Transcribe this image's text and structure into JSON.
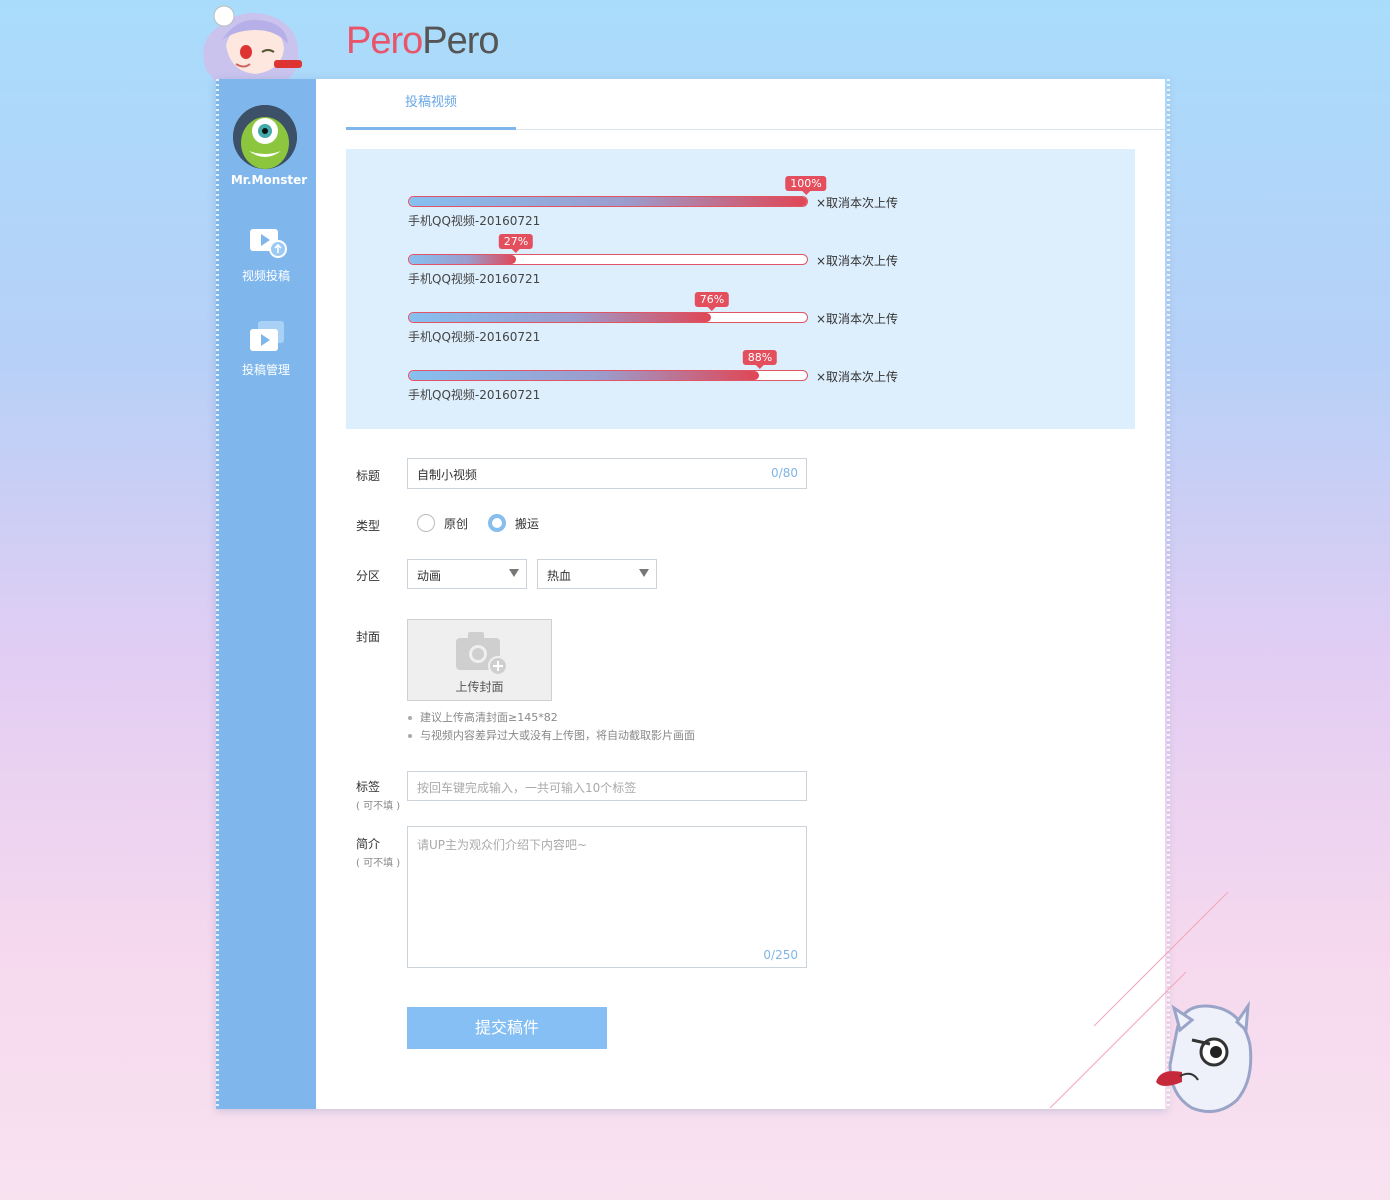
{
  "app": {
    "logo_part1": "Pero",
    "logo_part2": "Pero"
  },
  "user": {
    "name": "Mr.Monster"
  },
  "sidebar": {
    "items": [
      {
        "label": "视频投稿"
      },
      {
        "label": "投稿管理"
      }
    ]
  },
  "tabs": [
    {
      "label": "投稿视频"
    }
  ],
  "uploads": [
    {
      "file": "手机QQ视频-20160721",
      "progress": 100,
      "progress_label": "100%",
      "cancel": "×取消本次上传"
    },
    {
      "file": "手机QQ视频-20160721",
      "progress": 27,
      "progress_label": "27%",
      "cancel": "×取消本次上传"
    },
    {
      "file": "手机QQ视频-20160721",
      "progress": 76,
      "progress_label": "76%",
      "cancel": "×取消本次上传"
    },
    {
      "file": "手机QQ视频-20160721",
      "progress": 88,
      "progress_label": "88%",
      "cancel": "×取消本次上传"
    }
  ],
  "form": {
    "title_label": "标题",
    "title_value": "自制小视频",
    "title_count": "0/80",
    "type_label": "类型",
    "type_options": [
      "原创",
      "搬运"
    ],
    "type_selected": "搬运",
    "zone_label": "分区",
    "zone_primary": "动画",
    "zone_secondary": "热血",
    "cover_label": "封面",
    "cover_button": "上传封面",
    "cover_tips": [
      "建议上传高清封面≥145*82",
      "与视频内容差异过大或没有上传图，将自动截取影片画面"
    ],
    "tags_label": "标签",
    "tags_optional": "( 可不填 )",
    "tags_placeholder": "按回车键完成输入，一共可输入10个标签",
    "intro_label": "简介",
    "intro_optional": "( 可不填 )",
    "intro_placeholder": "请UP主为观众们介绍下内容吧~",
    "intro_count": "0/250",
    "submit_label": "提交稿件"
  },
  "colors": {
    "accent": "#7fb7ec",
    "progress_end": "#e34f5d",
    "submit": "#86bff3"
  }
}
